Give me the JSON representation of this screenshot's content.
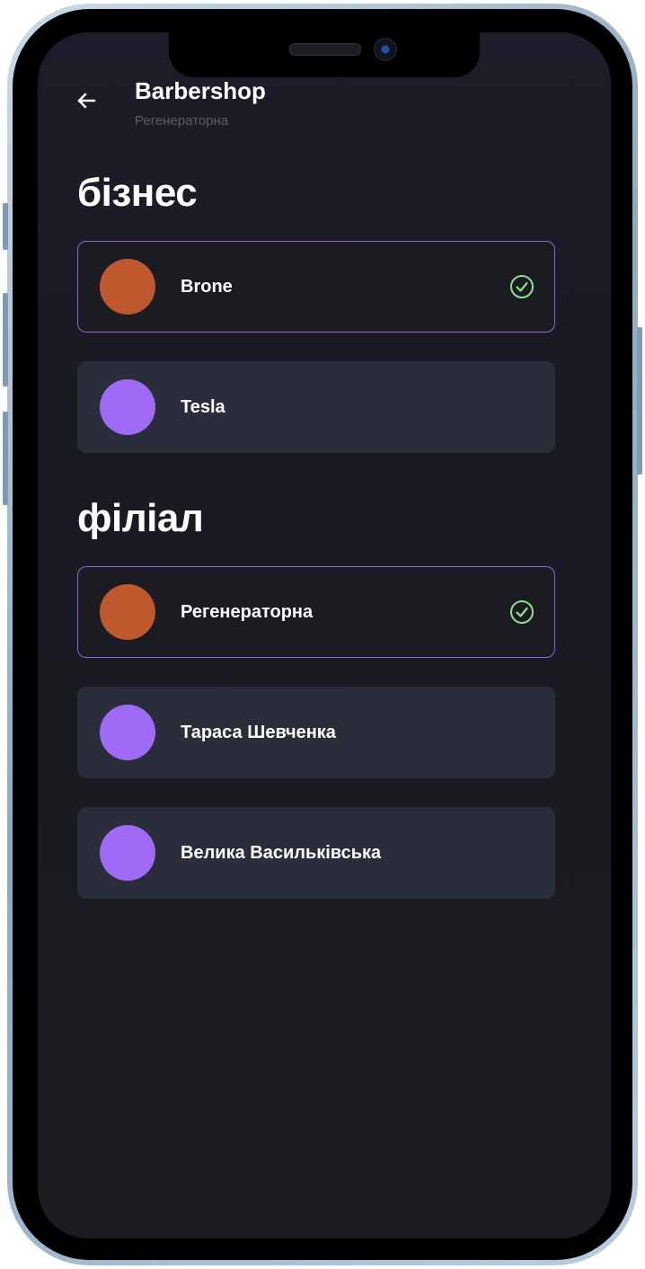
{
  "header": {
    "title": "Barbershop",
    "subtitle": "Регенераторна",
    "back_icon": "arrow-left-icon"
  },
  "sections": [
    {
      "heading": "бізнес",
      "items": [
        {
          "label": "Brone",
          "selected": true,
          "color": "#c0582d"
        },
        {
          "label": "Tesla",
          "selected": false,
          "color": "#a06bf4"
        }
      ]
    },
    {
      "heading": "філіал",
      "items": [
        {
          "label": "Регенераторна",
          "selected": true,
          "color": "#c0582d"
        },
        {
          "label": "Тараса Шевченка",
          "selected": false,
          "color": "#a06bf4"
        },
        {
          "label": "Велика Васильківська",
          "selected": false,
          "color": "#a06bf4"
        }
      ]
    }
  ],
  "colors": {
    "accent": "#9d5ee6",
    "check": "#8ee08a",
    "card_bg": "#2a2d3a",
    "screen_bg": "#1b1b20"
  }
}
